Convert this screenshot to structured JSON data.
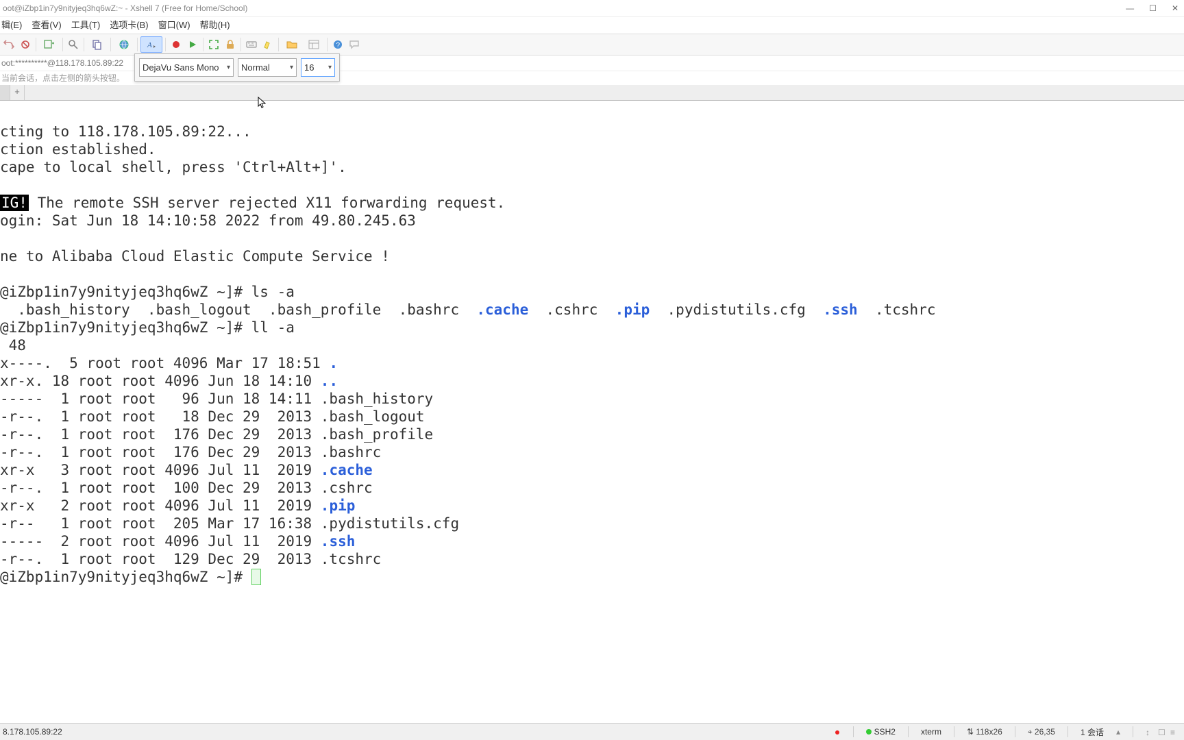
{
  "window": {
    "title": "oot@iZbp1in7y9nityjeq3hq6wZ:~ - Xshell 7 (Free for Home/School)"
  },
  "menubar": [
    "辑(E)",
    "查看(V)",
    "工具(T)",
    "选项卡(B)",
    "窗口(W)",
    "帮助(H)"
  ],
  "addressbar": "oot:**********@118.178.105.89:22",
  "hint": "当前会话，点击左侧的箭头按钮。",
  "font_popup": {
    "font_name": "DejaVu Sans Mono",
    "font_style": "Normal",
    "font_size": "16"
  },
  "terminal": {
    "l1": "cting to 118.178.105.89:22...",
    "l2": "ction established.",
    "l3": "cape to local shell, press 'Ctrl+Alt+]'.",
    "l4": "",
    "warn_tag": "IG!",
    "l5_rest": " The remote SSH server rejected X11 forwarding request.",
    "l6": "ogin: Sat Jun 18 14:10:58 2022 from 49.80.245.63",
    "l7": "",
    "l8": "ne to Alibaba Cloud Elastic Compute Service !",
    "l9": "",
    "prompt1": "@iZbp1in7y9nityjeq3hq6wZ ~]# ls -a",
    "ls_a": "  .bash_history  .bash_logout  .bash_profile  .bashrc  ",
    "ls_cache": ".cache",
    "ls_b": "  .cshrc  ",
    "ls_pip": ".pip",
    "ls_c": "  .pydistutils.cfg  ",
    "ls_ssh": ".ssh",
    "ls_d": "  .tcshrc",
    "prompt2": "@iZbp1in7y9nityjeq3hq6wZ ~]# ll -a",
    "total": " 48",
    "r01a": "x----.  5 root root 4096 Mar 17 18:51 ",
    "r01b": ".",
    "r02a": "xr-x. 18 root root 4096 Jun 18 14:10 ",
    "r02b": "..",
    "r03": "-----  1 root root   96 Jun 18 14:11 .bash_history",
    "r04": "-r--.  1 root root   18 Dec 29  2013 .bash_logout",
    "r05": "-r--.  1 root root  176 Dec 29  2013 .bash_profile",
    "r06": "-r--.  1 root root  176 Dec 29  2013 .bashrc",
    "r07a": "xr-x   3 root root 4096 Jul 11  2019 ",
    "r07b": ".cache",
    "r08": "-r--.  1 root root  100 Dec 29  2013 .cshrc",
    "r09a": "xr-x   2 root root 4096 Jul 11  2019 ",
    "r09b": ".pip",
    "r10": "-r--   1 root root  205 Mar 17 16:38 .pydistutils.cfg",
    "r11a": "-----  2 root root 4096 Jul 11  2019 ",
    "r11b": ".ssh",
    "r12": "-r--.  1 root root  129 Dec 29  2013 .tcshrc",
    "prompt3": "@iZbp1in7y9nityjeq3hq6wZ ~]# "
  },
  "statusbar": {
    "left": "8.178.105.89:22",
    "ssh": "SSH2",
    "term": "xterm",
    "dim": "118x26",
    "pos": "26,35",
    "sess": "1 会话"
  }
}
